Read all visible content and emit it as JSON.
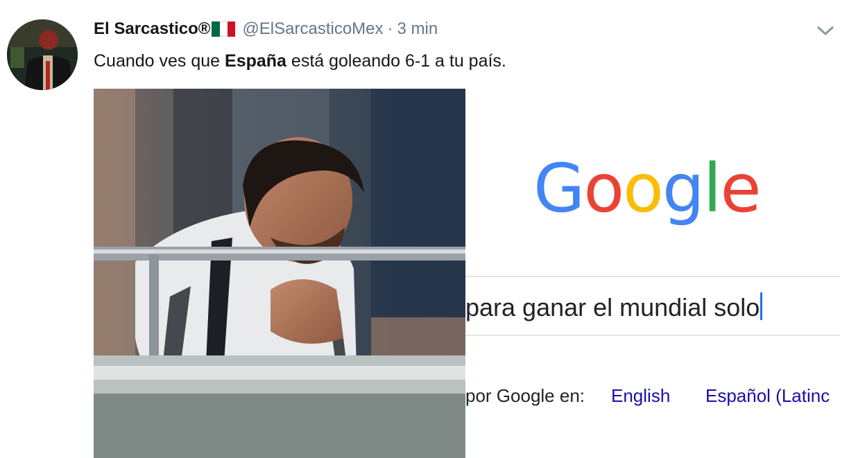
{
  "tweet": {
    "author_name": "El Sarcastico®",
    "handle": "@ElSarcasticoMex",
    "separator": "·",
    "time": "3 min",
    "text_before": "Cuando ves que ",
    "text_bold": "España",
    "text_after": " está goleando 6-1 a tu país.",
    "menu_icon": "chevron-down-icon",
    "flag_icon": "mexico-flag-icon",
    "flag_colors": [
      "#006847",
      "#ffffff",
      "#ce1126"
    ]
  },
  "google": {
    "logo_letters": [
      {
        "char": "G",
        "color": "#4285f4"
      },
      {
        "char": "o",
        "color": "#ea4335"
      },
      {
        "char": "o",
        "color": "#fbbc05"
      },
      {
        "char": "g",
        "color": "#4285f4"
      },
      {
        "char": "l",
        "color": "#34a853"
      },
      {
        "char": "e",
        "color": "#ea4335"
      }
    ],
    "search_query": "para ganar el mundial solo",
    "offered_in": "por Google en:",
    "languages": [
      "English",
      "Español (Latinc"
    ]
  }
}
